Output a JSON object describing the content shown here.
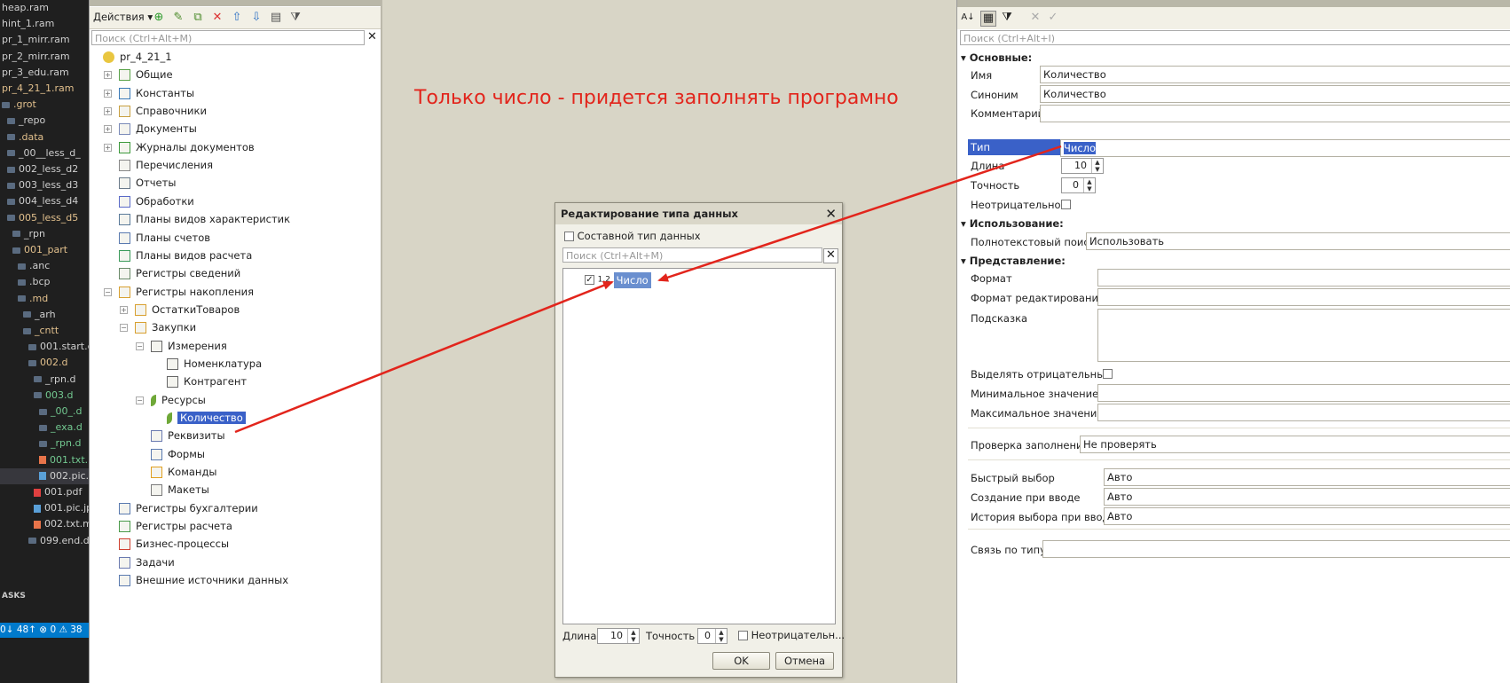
{
  "explorer": {
    "items": [
      {
        "label": "heap.ram",
        "color": "#cfcfcf",
        "indent": 0,
        "type": "file"
      },
      {
        "label": "hint_1.ram",
        "color": "#cfcfcf",
        "indent": 0,
        "type": "file"
      },
      {
        "label": "pr_1_mirr.ram",
        "color": "#cfcfcf",
        "indent": 0,
        "type": "file"
      },
      {
        "label": "pr_2_mirr.ram",
        "color": "#cfcfcf",
        "indent": 0,
        "type": "file"
      },
      {
        "label": "pr_3_edu.ram",
        "color": "#cfcfcf",
        "indent": 0,
        "type": "file"
      },
      {
        "label": "pr_4_21_1.ram",
        "color": "#e2c08d",
        "indent": 0,
        "type": "file"
      },
      {
        "label": ".grot",
        "color": "#e2c08d",
        "indent": 0,
        "type": "folder"
      },
      {
        "label": "_repo",
        "color": "#cfcfcf",
        "indent": 1,
        "type": "folder"
      },
      {
        "label": ".data",
        "color": "#e2c08d",
        "indent": 1,
        "type": "folder"
      },
      {
        "label": "_00__less_d_",
        "color": "#cfcfcf",
        "indent": 1,
        "type": "folder"
      },
      {
        "label": "002_less_d2",
        "color": "#cfcfcf",
        "indent": 1,
        "type": "folder"
      },
      {
        "label": "003_less_d3",
        "color": "#cfcfcf",
        "indent": 1,
        "type": "folder"
      },
      {
        "label": "004_less_d4",
        "color": "#cfcfcf",
        "indent": 1,
        "type": "folder"
      },
      {
        "label": "005_less_d5",
        "color": "#e2c08d",
        "indent": 1,
        "type": "folder"
      },
      {
        "label": "_rpn",
        "color": "#cfcfcf",
        "indent": 2,
        "type": "folder"
      },
      {
        "label": "001_part",
        "color": "#e2c08d",
        "indent": 2,
        "type": "folder"
      },
      {
        "label": ".anc",
        "color": "#cfcfcf",
        "indent": 3,
        "type": "folder"
      },
      {
        "label": ".bcp",
        "color": "#cfcfcf",
        "indent": 3,
        "type": "folder"
      },
      {
        "label": ".md",
        "color": "#e2c08d",
        "indent": 3,
        "type": "folder"
      },
      {
        "label": "_arh",
        "color": "#cfcfcf",
        "indent": 4,
        "type": "folder"
      },
      {
        "label": "_cntt",
        "color": "#e2c08d",
        "indent": 4,
        "type": "folder"
      },
      {
        "label": "001.start.c",
        "color": "#cfcfcf",
        "indent": 5,
        "type": "folder"
      },
      {
        "label": "002.d",
        "color": "#e2c08d",
        "indent": 5,
        "type": "folder"
      },
      {
        "label": "_rpn.d",
        "color": "#cfcfcf",
        "indent": 6,
        "type": "folder"
      },
      {
        "label": "003.d",
        "color": "#73c991",
        "indent": 6,
        "type": "folder"
      },
      {
        "label": "_00_.d",
        "color": "#73c991",
        "indent": 7,
        "type": "folder"
      },
      {
        "label": "_exa.d",
        "color": "#73c991",
        "indent": 7,
        "type": "folder"
      },
      {
        "label": "_rpn.d",
        "color": "#73c991",
        "indent": 7,
        "type": "folder"
      },
      {
        "label": "001.txt.",
        "color": "#73c991",
        "indent": 7,
        "type": "txt"
      },
      {
        "label": "002.pic.",
        "color": "#cfcfcf",
        "indent": 7,
        "type": "pic",
        "selected": true
      },
      {
        "label": "001.pdf",
        "color": "#cfcfcf",
        "indent": 6,
        "type": "pdf"
      },
      {
        "label": "001.pic.jp",
        "color": "#cfcfcf",
        "indent": 6,
        "type": "pic"
      },
      {
        "label": "002.txt.m",
        "color": "#cfcfcf",
        "indent": 6,
        "type": "txt"
      },
      {
        "label": "099.end.d",
        "color": "#cfcfcf",
        "indent": 5,
        "type": "folder"
      }
    ],
    "tasks_label": "ASKS",
    "status_text": "0↓ 48↑   ⊗ 0 ⚠ 38"
  },
  "config": {
    "actions_label": "Действия ▾",
    "search_placeholder": "Поиск (Ctrl+Alt+M)",
    "tree": [
      {
        "label": "pr_4_21_1",
        "level": 0,
        "exp": "",
        "icon": "root"
      },
      {
        "label": "Общие",
        "level": 1,
        "exp": "+",
        "icon": "common"
      },
      {
        "label": "Константы",
        "level": 1,
        "exp": "+",
        "icon": "const"
      },
      {
        "label": "Справочники",
        "level": 1,
        "exp": "+",
        "icon": "catalog"
      },
      {
        "label": "Документы",
        "level": 1,
        "exp": "+",
        "icon": "doc"
      },
      {
        "label": "Журналы документов",
        "level": 1,
        "exp": "+",
        "icon": "journal"
      },
      {
        "label": "Перечисления",
        "level": 1,
        "exp": "",
        "icon": "enum"
      },
      {
        "label": "Отчеты",
        "level": 1,
        "exp": "",
        "icon": "report"
      },
      {
        "label": "Обработки",
        "level": 1,
        "exp": "",
        "icon": "proc"
      },
      {
        "label": "Планы видов характеристик",
        "level": 1,
        "exp": "",
        "icon": "plan"
      },
      {
        "label": "Планы счетов",
        "level": 1,
        "exp": "",
        "icon": "accounts"
      },
      {
        "label": "Планы видов расчета",
        "level": 1,
        "exp": "",
        "icon": "calc"
      },
      {
        "label": "Регистры сведений",
        "level": 1,
        "exp": "",
        "icon": "inforeg"
      },
      {
        "label": "Регистры накопления",
        "level": 1,
        "exp": "−",
        "icon": "accumreg"
      },
      {
        "label": "ОстаткиТоваров",
        "level": 2,
        "exp": "+",
        "icon": "accumreg"
      },
      {
        "label": "Закупки",
        "level": 2,
        "exp": "−",
        "icon": "accumreg"
      },
      {
        "label": "Измерения",
        "level": 3,
        "exp": "−",
        "icon": "dims"
      },
      {
        "label": "Номенклатура",
        "level": 4,
        "exp": "",
        "icon": "dims"
      },
      {
        "label": "Контрагент",
        "level": 4,
        "exp": "",
        "icon": "dims"
      },
      {
        "label": "Ресурсы",
        "level": 3,
        "exp": "−",
        "icon": "res"
      },
      {
        "label": "Количество",
        "level": 4,
        "exp": "",
        "icon": "res",
        "selected": true
      },
      {
        "label": "Реквизиты",
        "level": 3,
        "exp": "",
        "icon": "attr"
      },
      {
        "label": "Формы",
        "level": 3,
        "exp": "",
        "icon": "form"
      },
      {
        "label": "Команды",
        "level": 3,
        "exp": "",
        "icon": "cmd"
      },
      {
        "label": "Макеты",
        "level": 3,
        "exp": "",
        "icon": "layout"
      },
      {
        "label": "Регистры бухгалтерии",
        "level": 1,
        "exp": "",
        "icon": "acc"
      },
      {
        "label": "Регистры расчета",
        "level": 1,
        "exp": "",
        "icon": "calcreg"
      },
      {
        "label": "Бизнес-процессы",
        "level": 1,
        "exp": "",
        "icon": "bp"
      },
      {
        "label": "Задачи",
        "level": 1,
        "exp": "",
        "icon": "task"
      },
      {
        "label": "Внешние источники данных",
        "level": 1,
        "exp": "",
        "icon": "ext"
      }
    ]
  },
  "annotation": "Только число - придется заполнять програмно",
  "dialog": {
    "title": "Редактирование типа данных",
    "composite_label": "Составной тип данных",
    "search_placeholder": "Поиск (Ctrl+Alt+M)",
    "type_item": "Число",
    "type_glyph": "1.2",
    "length_label": "Длина",
    "length_value": "10",
    "precision_label": "Точность",
    "precision_value": "0",
    "nonneg_label": "Неотрицательн...",
    "ok_label": "OK",
    "cancel_label": "Отмена"
  },
  "props": {
    "search_placeholder": "Поиск (Ctrl+Alt+I)",
    "section_main": "Основные:",
    "name_label": "Имя",
    "name_value": "Количество",
    "synonym_label": "Синоним",
    "synonym_value": "Количество",
    "comment_label": "Комментарий",
    "type_label": "Тип",
    "type_value": "Число",
    "length_label": "Длина",
    "length_value": "10",
    "precision_label": "Точность",
    "precision_value": "0",
    "nonneg_label": "Неотрицательное",
    "section_usage": "Использование:",
    "fulltext_label": "Полнотекстовый поиск",
    "fulltext_value": "Использовать",
    "section_view": "Представление:",
    "format_label": "Формат",
    "editformat_label": "Формат редактирования",
    "tooltip_label": "Подсказка",
    "highlight_neg_label": "Выделять отрицательные",
    "min_label": "Минимальное значение",
    "max_label": "Максимальное значение",
    "fillcheck_label": "Проверка заполнения",
    "fillcheck_value": "Не проверять",
    "quickchoice_label": "Быстрый выбор",
    "quickchoice_value": "Авто",
    "createoninput_label": "Создание при вводе",
    "createoninput_value": "Авто",
    "history_label": "История выбора при вводе",
    "history_value": "Авто",
    "typelink_label": "Связь по типу"
  },
  "colors": {
    "arrow": "#e2251c",
    "selection": "#3a61c8",
    "dialog_selection": "#6a8fcf"
  }
}
